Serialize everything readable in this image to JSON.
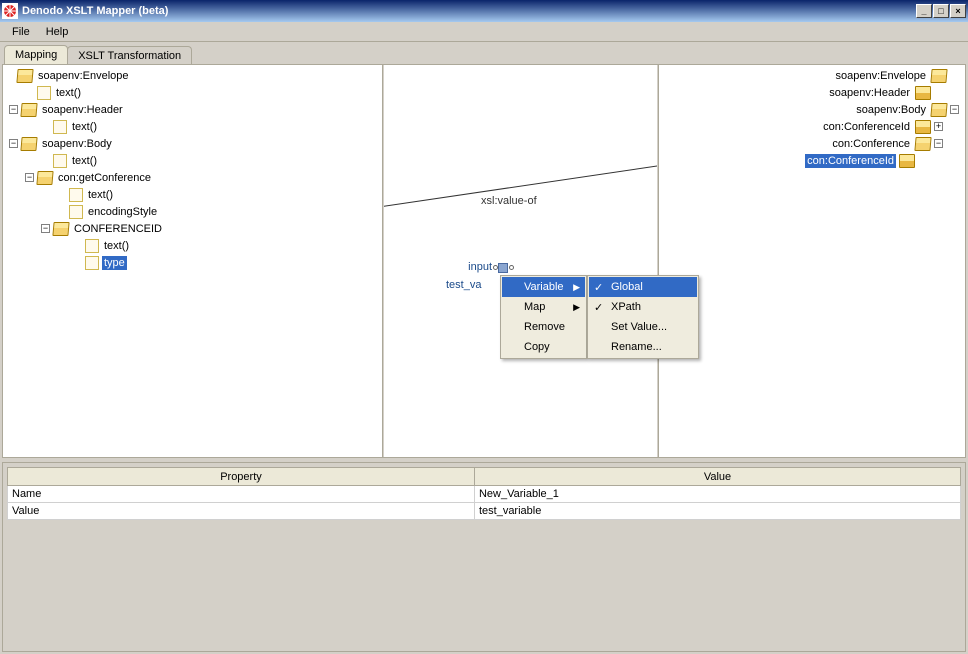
{
  "window": {
    "title": "Denodo XSLT Mapper (beta)"
  },
  "menubar": {
    "file": "File",
    "help": "Help"
  },
  "tabs": {
    "mapping": "Mapping",
    "xslt": "XSLT Transformation"
  },
  "left_tree": {
    "n0": "soapenv:Envelope",
    "n0_0": "text()",
    "n1": "soapenv:Header",
    "n1_0": "text()",
    "n2": "soapenv:Body",
    "n2_0": "text()",
    "n2_1": "con:getConference",
    "n2_1_0": "text()",
    "n2_1_1": "encodingStyle",
    "n2_1_2": "CONFERENCEID",
    "n2_1_2_0": "text()",
    "n2_1_2_1": "type"
  },
  "right_tree": {
    "n0": "soapenv:Envelope",
    "n1": "soapenv:Header",
    "n2": "soapenv:Body",
    "n3": "con:ConferenceId",
    "n4": "con:Conference",
    "n5": "con:ConferenceId"
  },
  "canvas": {
    "edge1_label": "xsl:value-of",
    "node_input": "input",
    "node_test": "test_va"
  },
  "context_menu": {
    "variable": "Variable",
    "map": "Map",
    "remove": "Remove",
    "copy": "Copy"
  },
  "submenu": {
    "global": "Global",
    "xpath": "XPath",
    "set_value": "Set Value...",
    "rename": "Rename..."
  },
  "properties": {
    "col_property": "Property",
    "col_value": "Value",
    "rows": [
      {
        "name": "Name",
        "value": "New_Variable_1"
      },
      {
        "name": "Value",
        "value": "test_variable"
      }
    ]
  }
}
